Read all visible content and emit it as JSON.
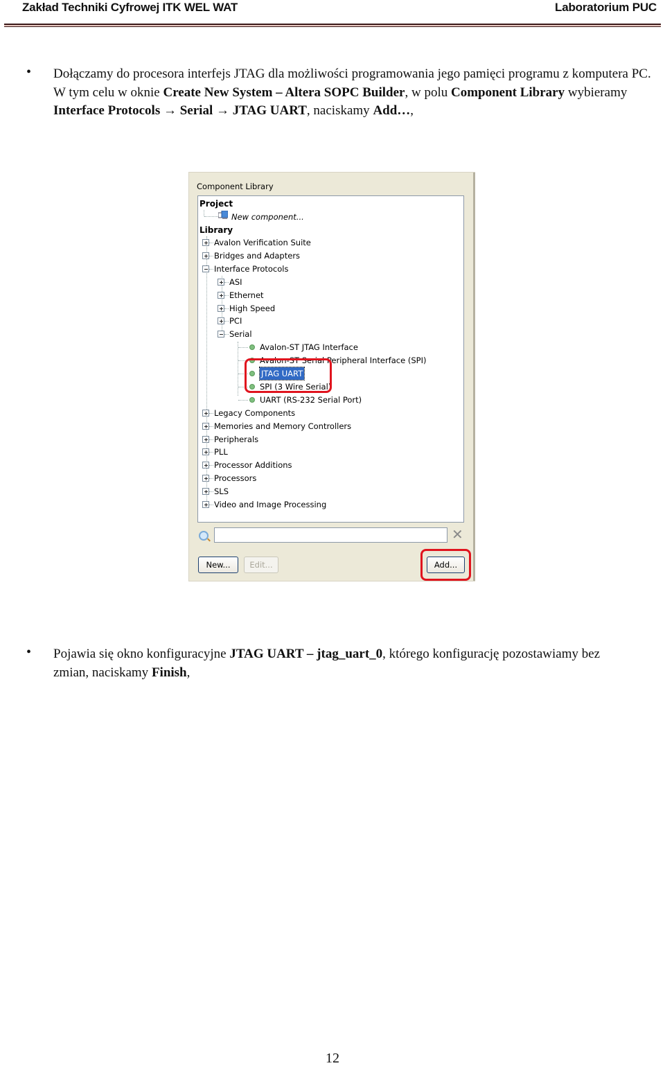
{
  "header": {
    "left": "Zakład Techniki Cyfrowej ITK WEL WAT",
    "right": "Laboratorium PUC"
  },
  "paragraph1": {
    "bullet": "•",
    "segments": [
      {
        "text": "Dołączamy do procesora interfejs JTAG dla możliwości programowania jego pamięci programu z komputera PC. W tym celu w oknie ",
        "bold": false
      },
      {
        "text": "Create New System – Altera SOPC Builder",
        "bold": true
      },
      {
        "text": ", w polu ",
        "bold": false
      },
      {
        "text": "Component Library",
        "bold": true
      },
      {
        "text": " wybieramy ",
        "bold": false
      },
      {
        "text": "Interface Protocols",
        "bold": true
      },
      {
        "text": " → ",
        "bold": false
      },
      {
        "text": "Serial",
        "bold": true
      },
      {
        "text": " → ",
        "bold": false
      },
      {
        "text": "JTAG UART",
        "bold": true
      },
      {
        "text": ", naciskamy ",
        "bold": false
      },
      {
        "text": "Add…",
        "bold": true
      },
      {
        "text": ",",
        "bold": false
      }
    ]
  },
  "panel": {
    "title": "Component Library",
    "project_section": "Project",
    "new_component": "New component...",
    "library_section": "Library",
    "tree": [
      {
        "label": "Avalon Verification Suite",
        "level": 0,
        "state": "collapsed"
      },
      {
        "label": "Bridges and Adapters",
        "level": 0,
        "state": "collapsed"
      },
      {
        "label": "Interface Protocols",
        "level": 0,
        "state": "expanded"
      },
      {
        "label": "ASI",
        "level": 1,
        "state": "collapsed"
      },
      {
        "label": "Ethernet",
        "level": 1,
        "state": "collapsed"
      },
      {
        "label": "High Speed",
        "level": 1,
        "state": "collapsed"
      },
      {
        "label": "PCI",
        "level": 1,
        "state": "collapsed"
      },
      {
        "label": "Serial",
        "level": 1,
        "state": "expanded"
      },
      {
        "label": "Avalon-ST JTAG Interface",
        "level": 2,
        "state": "leaf"
      },
      {
        "label": "Avalon-ST Serial Peripheral Interface (SPI)",
        "level": 2,
        "state": "leaf"
      },
      {
        "label": "JTAG UART",
        "level": 2,
        "state": "leaf",
        "selected": true
      },
      {
        "label": "SPI (3 Wire Serial)",
        "level": 2,
        "state": "leaf"
      },
      {
        "label": "UART (RS-232 Serial Port)",
        "level": 2,
        "state": "leaf"
      },
      {
        "label": "Legacy Components",
        "level": 0,
        "state": "collapsed"
      },
      {
        "label": "Memories and Memory Controllers",
        "level": 0,
        "state": "collapsed"
      },
      {
        "label": "Peripherals",
        "level": 0,
        "state": "collapsed"
      },
      {
        "label": "PLL",
        "level": 0,
        "state": "collapsed"
      },
      {
        "label": "Processor Additions",
        "level": 0,
        "state": "collapsed"
      },
      {
        "label": "Processors",
        "level": 0,
        "state": "collapsed"
      },
      {
        "label": "SLS",
        "level": 0,
        "state": "collapsed"
      },
      {
        "label": "Video and Image Processing",
        "level": 0,
        "state": "collapsed"
      }
    ],
    "search": {
      "value": "",
      "placeholder": ""
    },
    "buttons": {
      "new": "New...",
      "edit": "Edit...",
      "add": "Add..."
    },
    "highlight_color": "#e0141e",
    "selection_color": "#316ac5"
  },
  "paragraph2": {
    "bullet": "•",
    "segments": [
      {
        "text": "Pojawia się okno konfiguracyjne ",
        "bold": false
      },
      {
        "text": "JTAG UART – jtag_uart_0",
        "bold": true
      },
      {
        "text": ", którego konfigurację pozostawiamy bez zmian, naciskamy ",
        "bold": false
      },
      {
        "text": "Finish",
        "bold": true
      },
      {
        "text": ",",
        "bold": false
      }
    ]
  },
  "footer": {
    "page_number": "12"
  }
}
